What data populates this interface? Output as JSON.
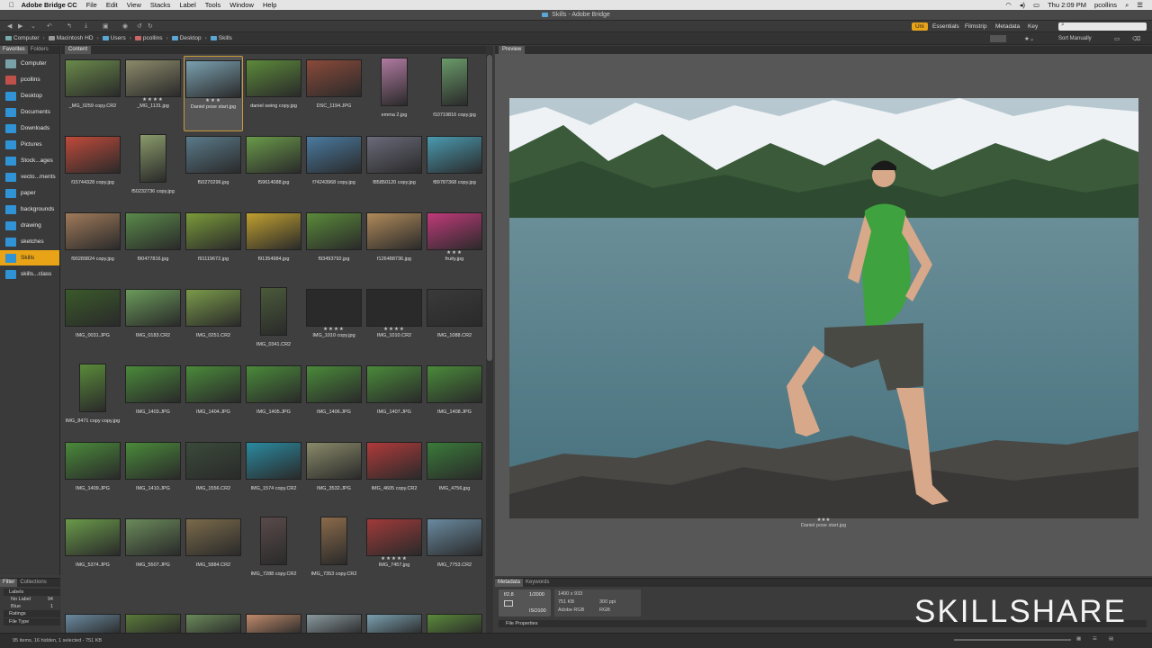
{
  "menubar": {
    "app_name": "Adobe Bridge CC",
    "items": [
      "File",
      "Edit",
      "View",
      "Stacks",
      "Label",
      "Tools",
      "Window",
      "Help"
    ],
    "clock": "Thu 2:09 PM",
    "user": "pcollins"
  },
  "window_title": "Skills - Adobe Bridge",
  "workspaces": [
    "Uni",
    "Essentials",
    "Filmstrip",
    "Metadata",
    "Key"
  ],
  "sort_label": "Sort Manually",
  "path": [
    "Computer",
    "Macintosh HD",
    "Users",
    "pcollins",
    "Desktop",
    "Skills"
  ],
  "left_tabs": [
    "Favorites",
    "Folders"
  ],
  "favorites": [
    "Computer",
    "pcollins",
    "Desktop",
    "Documents",
    "Downloads",
    "Pictures",
    "Stock...ages",
    "vecto...ments",
    "paper",
    "backgrounds",
    "drawing",
    "sketches",
    "Skills",
    "skills...class"
  ],
  "selected_favorite": "Skills",
  "filter": {
    "tabs": [
      "Filter",
      "Collections"
    ],
    "labels_header": "Labels",
    "rows": [
      {
        "label": "No Label",
        "count": "94"
      },
      {
        "label": "Blue",
        "count": "1"
      }
    ],
    "ratings": "Ratings",
    "filetype": "File Type"
  },
  "content_tab": "Content",
  "thumbnails": [
    {
      "name": "_MG_0259 copy.CR2",
      "stars": "",
      "c": "#6a8a4a",
      "p": false
    },
    {
      "name": "_MG_1131.jpg",
      "stars": "★★★★",
      "c": "#8c8a6a",
      "p": false
    },
    {
      "name": "Daniel pose start.jpg",
      "stars": "★★★",
      "c": "#7aa0b0",
      "p": false,
      "sel": true
    },
    {
      "name": "daniel swing copy.jpg",
      "stars": "",
      "c": "#5c8a3a",
      "p": false
    },
    {
      "name": "DSC_1194.JPG",
      "stars": "",
      "c": "#8a4a3a",
      "p": false
    },
    {
      "name": "emma 2.jpg",
      "stars": "",
      "c": "#b07aa0",
      "p": true
    },
    {
      "name": "f10719816 copy.jpg",
      "stars": "",
      "c": "#6a9a6a",
      "p": true
    },
    {
      "name": "f15744328 copy.jpg",
      "stars": "",
      "c": "#c04a3a",
      "p": false
    },
    {
      "name": "f50232736 copy.jpg",
      "stars": "",
      "c": "#8a9a6a",
      "p": true
    },
    {
      "name": "f50270296.jpg",
      "stars": "",
      "c": "#5a7a8a",
      "p": false
    },
    {
      "name": "f59614088.jpg",
      "stars": "",
      "c": "#6a9a4a",
      "p": false
    },
    {
      "name": "f74243968 copy.jpg",
      "stars": "",
      "c": "#4a7aa0",
      "p": false
    },
    {
      "name": "f85850120 copy.jpg",
      "stars": "",
      "c": "#6a6a7a",
      "p": false
    },
    {
      "name": "f89787368 copy.jpg",
      "stars": "",
      "c": "#4a9ab0",
      "p": false
    },
    {
      "name": "f90289824 copy.jpg",
      "stars": "",
      "c": "#a07a5a",
      "p": false
    },
    {
      "name": "f90477816.jpg",
      "stars": "",
      "c": "#5a8a4a",
      "p": false
    },
    {
      "name": "f91119672.jpg",
      "stars": "",
      "c": "#7a9a3a",
      "p": false
    },
    {
      "name": "f91354984.jpg",
      "stars": "",
      "c": "#c0a030",
      "p": false
    },
    {
      "name": "f93493792.jpg",
      "stars": "",
      "c": "#5a8a3a",
      "p": false
    },
    {
      "name": "f126488736.jpg",
      "stars": "",
      "c": "#b08a5a",
      "p": false
    },
    {
      "name": "fruity.jpg",
      "stars": "★★★",
      "c": "#c03a7a",
      "p": false
    },
    {
      "name": "IMG_0031.JPG",
      "stars": "",
      "c": "#3a5a2a",
      "p": false
    },
    {
      "name": "IMG_0183.CR2",
      "stars": "",
      "c": "#6a9a5a",
      "p": false
    },
    {
      "name": "IMG_0251.CR2",
      "stars": "",
      "c": "#7a9a4a",
      "p": false
    },
    {
      "name": "IMG_0341.CR2",
      "stars": "",
      "c": "#4a5a3a",
      "p": true
    },
    {
      "name": "IMG_1010 copy.jpg",
      "stars": "★★★★",
      "c": "#2a2a2a",
      "p": false
    },
    {
      "name": "IMG_1010.CR2",
      "stars": "★★★★",
      "c": "#2a2a2a",
      "p": false
    },
    {
      "name": "IMG_1088.CR2",
      "stars": "",
      "c": "#3a3a3a",
      "p": false
    },
    {
      "name": "IMG_8471 copy copy.jpg",
      "stars": "",
      "c": "#5a8a3a",
      "p": true
    },
    {
      "name": "IMG_1403.JPG",
      "stars": "",
      "c": "#4a8a3a",
      "p": false
    },
    {
      "name": "IMG_1404.JPG",
      "stars": "",
      "c": "#4a8a3a",
      "p": false
    },
    {
      "name": "IMG_1405.JPG",
      "stars": "",
      "c": "#4a8a3a",
      "p": false
    },
    {
      "name": "IMG_1406.JPG",
      "stars": "",
      "c": "#4a8a3a",
      "p": false
    },
    {
      "name": "IMG_1407.JPG",
      "stars": "",
      "c": "#4a8a3a",
      "p": false
    },
    {
      "name": "IMG_1408.JPG",
      "stars": "",
      "c": "#4a8a3a",
      "p": false
    },
    {
      "name": "IMG_1409.JPG",
      "stars": "",
      "c": "#4a8a3a",
      "p": false
    },
    {
      "name": "IMG_1410.JPG",
      "stars": "",
      "c": "#4a8a3a",
      "p": false
    },
    {
      "name": "IMG_1556.CR2",
      "stars": "",
      "c": "#3a4a3a",
      "p": false
    },
    {
      "name": "IMG_1574 copy.CR2",
      "stars": "",
      "c": "#2a8aa0",
      "p": false
    },
    {
      "name": "IMG_3532.JPG",
      "stars": "",
      "c": "#8a8a6a",
      "p": false
    },
    {
      "name": "IMG_4605 copy.CR2",
      "stars": "",
      "c": "#b03a3a",
      "p": false
    },
    {
      "name": "IMG_4756.jpg",
      "stars": "",
      "c": "#3a7a3a",
      "p": false
    },
    {
      "name": "IMG_5374.JPG",
      "stars": "",
      "c": "#6a9a4a",
      "p": false
    },
    {
      "name": "IMG_5507.JPG",
      "stars": "",
      "c": "#6a8a5a",
      "p": false
    },
    {
      "name": "IMG_5884.CR2",
      "stars": "",
      "c": "#7a6a4a",
      "p": false
    },
    {
      "name": "IMG_7288 copy.CR2",
      "stars": "",
      "c": "#5a4a4a",
      "p": true
    },
    {
      "name": "IMG_7353 copy.CR2",
      "stars": "",
      "c": "#8a6a4a",
      "p": true
    },
    {
      "name": "IMG_7457.jpg",
      "stars": "★★★★★",
      "c": "#a03a3a",
      "p": false
    },
    {
      "name": "IMG_7753.CR2",
      "stars": "",
      "c": "#6a8aa0",
      "p": false
    }
  ],
  "partial_row": [
    "#6a8aa0",
    "#5a7a3a",
    "#6a8a5a",
    "#c08a6a",
    "#8a9aa0",
    "#7aa0b0",
    "#5a8a3a",
    "#6a9a4a"
  ],
  "preview_tab": "Preview",
  "preview_caption": "Daniel pose start.jpg",
  "preview_stars": "★★★",
  "metadata": {
    "tabs": [
      "Metadata",
      "Keywords"
    ],
    "aperture": "f/2.8",
    "shutter": "1/2000",
    "iso": "ISO100",
    "dimensions": "1400 x 933",
    "size": "751 KB",
    "resolution": "300 ppi",
    "profile": "Adobe RGB",
    "mode": "RGB",
    "file_properties": "File Properties"
  },
  "status": "95 items, 16 hidden, 1 selected - 751 KB",
  "watermark": "SKILLSHARE"
}
